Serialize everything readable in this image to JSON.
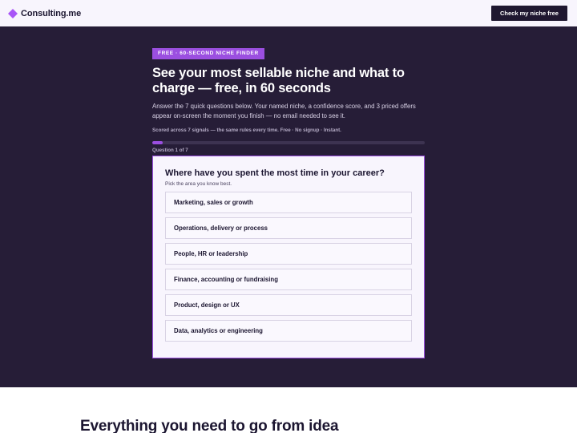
{
  "header": {
    "brand_name": "Consulting.me",
    "cta_label": "Check my niche free"
  },
  "hero": {
    "badge": "FREE · 60-SECOND NICHE FINDER",
    "headline": "See your most sellable niche and what to charge — free, in 60 seconds",
    "subtext": "Answer the 7 quick questions below. Your named niche, a confidence score, and 3 priced offers appear on-screen the moment you finish — no email needed to see it.",
    "meta": "Scored across 7 signals — the same rules every time. Free · No signup · Instant.",
    "progress_fraction": 0.0385,
    "question_counter": "Question 1 of 7"
  },
  "question": {
    "title": "Where have you spent the most time in your career?",
    "hint": "Pick the area you know best.",
    "options": [
      "Marketing, sales or growth",
      "Operations, delivery or process",
      "People, HR or leadership",
      "Finance, accounting or fundraising",
      "Product, design or UX",
      "Data, analytics or engineering"
    ]
  },
  "next_section": {
    "title": "Everything you need to go from idea"
  },
  "colors": {
    "accent": "#9b4fe0",
    "hero_bg": "#261d37",
    "dark_button": "#1f1730"
  }
}
